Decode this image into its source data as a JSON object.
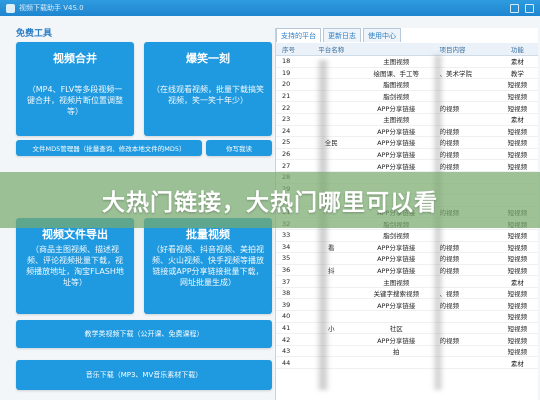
{
  "window": {
    "title": "视频下载助手 V4S.0"
  },
  "left": {
    "section_title": "免费工具",
    "tiles": [
      {
        "title": "视频合并",
        "desc": "（MP4、FLV等多段视频一键合并，视频片断位置调整等）"
      },
      {
        "title": "爆笑一刻",
        "desc": "（在线观看视频，批量下载搞笑视频，笑一笑十年少）"
      },
      {
        "title": "视频文件导出",
        "desc": "（商品主图视频、描述视频、评论视频批量下载，视频播放地址，淘宝FLASH地址等）"
      },
      {
        "title": "批量视频",
        "desc": "（好看视频、抖音视频、美拍视频、火山视频、快手视频等播放链接或APP分享链接批量下载，网址批量生成）"
      }
    ],
    "buttons": {
      "md5": "文件MD5管理器（批量查询、修改本地文件的MD5）",
      "review": "你写我读",
      "teach": "教学类视频下载（公开课、免费课程）",
      "music": "音乐下载（MP3、MV音乐素材下载）"
    }
  },
  "right": {
    "tabs": [
      "支持的平台",
      "更新日志",
      "使用中心"
    ],
    "columns": [
      "序号",
      "平台名称",
      "",
      "项目内容",
      "功能"
    ],
    "rows": [
      [
        "18",
        "",
        "主图视频",
        "",
        "素材"
      ],
      [
        "19",
        "",
        "绘图课、手工等",
        "、美术学院",
        "教学"
      ],
      [
        "20",
        "",
        "脂图视频",
        "",
        "短视频"
      ],
      [
        "21",
        "",
        "脂剑视频",
        "",
        "短视频"
      ],
      [
        "22",
        "",
        "APP分享链接",
        "的视频",
        "短视频"
      ],
      [
        "23",
        "",
        "主图视频",
        "",
        "素材"
      ],
      [
        "24",
        "",
        "APP分享链接",
        "的视频",
        "短视频"
      ],
      [
        "25",
        "全民",
        "APP分享链接",
        "的视频",
        "短视频"
      ],
      [
        "26",
        "",
        "APP分享链接",
        "的视频",
        "短视频"
      ],
      [
        "27",
        "",
        "APP分享链接",
        "的视频",
        "短视频"
      ],
      [
        "28",
        "",
        "",
        "",
        ""
      ],
      [
        "29",
        "",
        "",
        "",
        ""
      ],
      [
        "30",
        "",
        "",
        "",
        ""
      ],
      [
        "31",
        "",
        "APP分享链接",
        "的视频",
        "短视频"
      ],
      [
        "32",
        "",
        "脂剑视频",
        "",
        "短视频"
      ],
      [
        "33",
        "",
        "脂剑视频",
        "",
        "短视频"
      ],
      [
        "34",
        "看",
        "APP分享链接",
        "的视频",
        "短视频"
      ],
      [
        "35",
        "",
        "APP分享链接",
        "的视频",
        "短视频"
      ],
      [
        "36",
        "抖",
        "APP分享链接",
        "的视频",
        "短视频"
      ],
      [
        "37",
        "",
        "主图视频",
        "",
        "素材"
      ],
      [
        "38",
        "",
        "关键字搜索视频",
        "、视频",
        "短视频"
      ],
      [
        "39",
        "",
        "APP分享链接",
        "的视频",
        "短视频"
      ],
      [
        "40",
        "",
        "",
        "",
        "短视频"
      ],
      [
        "41",
        "小",
        "社区",
        "",
        "短视频"
      ],
      [
        "42",
        "",
        "APP分享链接",
        "的视频",
        "短视频"
      ],
      [
        "43",
        "",
        "拍",
        "",
        "短视频"
      ],
      [
        "44",
        "",
        "",
        "",
        "素材"
      ]
    ]
  },
  "banner": {
    "text": "大热门链接，大热门哪里可以看"
  }
}
